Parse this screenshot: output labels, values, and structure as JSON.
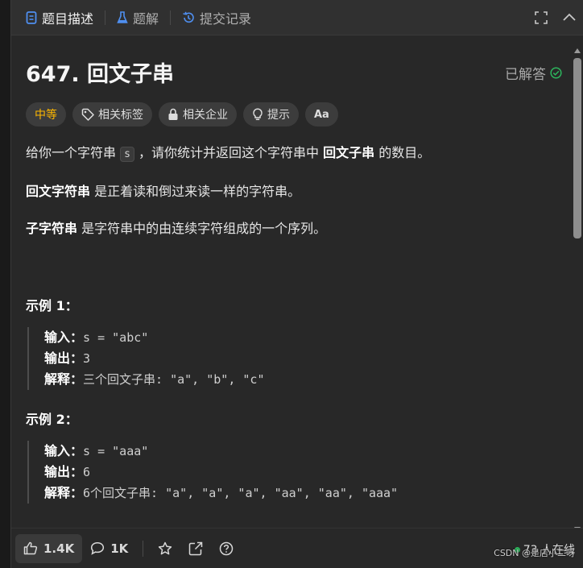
{
  "tabs": [
    {
      "label": "题目描述",
      "icon": "document-icon",
      "active": true
    },
    {
      "label": "题解",
      "icon": "flask-icon",
      "active": false
    },
    {
      "label": "提交记录",
      "icon": "history-icon",
      "active": false
    }
  ],
  "problem": {
    "title": "647. 回文子串",
    "status": "已解答",
    "difficulty": "中等",
    "tags": [
      "相关标签",
      "相关企业",
      "提示"
    ],
    "translate_icon_label": "Aa"
  },
  "description": {
    "p1_before": "给你一个字符串 ",
    "p1_code": "s",
    "p1_mid": " ，请你统计并返回这个字符串中 ",
    "p1_bold": "回文子串",
    "p1_after": " 的数目。",
    "p2_bold": "回文字符串",
    "p2_after": " 是正着读和倒过来读一样的字符串。",
    "p3_bold": "子字符串",
    "p3_after": " 是字符串中的由连续字符组成的一个序列。"
  },
  "examples": [
    {
      "title": "示例 1：",
      "input_label": "输入：",
      "input": "s = \"abc\"",
      "output_label": "输出：",
      "output": "3",
      "explain_label": "解释：",
      "explain": "三个回文子串: \"a\", \"b\", \"c\""
    },
    {
      "title": "示例 2：",
      "input_label": "输入：",
      "input": "s = \"aaa\"",
      "output_label": "输出：",
      "output": "6",
      "explain_label": "解释：",
      "explain": "6个回文子串: \"a\", \"a\", \"a\", \"aa\", \"aa\", \"aaa\""
    }
  ],
  "footer": {
    "likes": "1.4K",
    "comments": "1K",
    "online": "73 人在线",
    "watermark": "CSDN @是店小二呀"
  },
  "colors": {
    "accent_difficulty": "#ffb800",
    "solved_check": "#2db55d",
    "background": "#282828"
  }
}
